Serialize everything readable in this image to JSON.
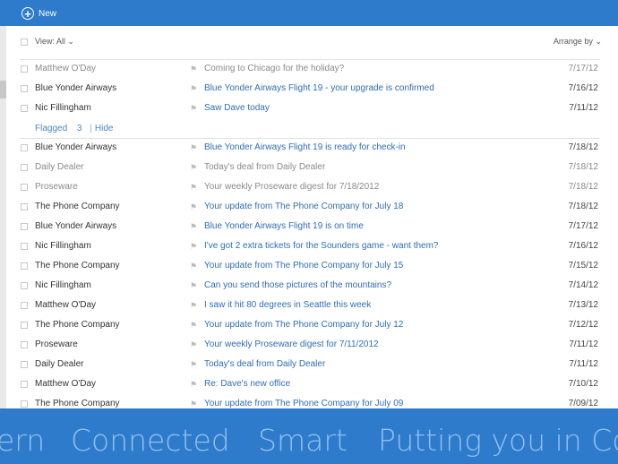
{
  "header": {
    "new_label": "New"
  },
  "toolbar": {
    "view_label": "View: All",
    "arrange_label": "Arrange by"
  },
  "top_messages": [
    {
      "sender": "Matthew O'Day",
      "subject": "Coming to Chicago for the holiday?",
      "date": "7/17/12",
      "unread": false
    },
    {
      "sender": "Blue Yonder Airways",
      "subject": "Blue Yonder Airways Flight 19 - your upgrade is confirmed",
      "date": "7/16/12",
      "unread": true
    },
    {
      "sender": "Nic Fillingham",
      "subject": "Saw Dave today",
      "date": "7/11/12",
      "unread": true
    }
  ],
  "flagged": {
    "label": "Flagged",
    "count": "3",
    "hide_label": "Hide"
  },
  "messages": [
    {
      "sender": "Blue Yonder Airways",
      "subject": "Blue Yonder Airways Flight 19 is ready for check-in",
      "date": "7/18/12",
      "unread": true
    },
    {
      "sender": "Daily Dealer",
      "subject": "Today's deal from Daily Dealer",
      "date": "7/18/12",
      "unread": false
    },
    {
      "sender": "Proseware",
      "subject": "Your weekly Proseware digest for 7/18/2012",
      "date": "7/18/12",
      "unread": false
    },
    {
      "sender": "The Phone Company",
      "subject": "Your update from The Phone Company for July 18",
      "date": "7/18/12",
      "unread": true
    },
    {
      "sender": "Blue Yonder Airways",
      "subject": "Blue Yonder Airways Flight 19 is on time",
      "date": "7/17/12",
      "unread": true
    },
    {
      "sender": "Nic Fillingham",
      "subject": "I've got 2 extra tickets for the Sounders game - want them?",
      "date": "7/16/12",
      "unread": true
    },
    {
      "sender": "The Phone Company",
      "subject": "Your update from The Phone Company for July 15",
      "date": "7/15/12",
      "unread": true
    },
    {
      "sender": "Nic Fillingham",
      "subject": "Can you send those pictures of the mountains?",
      "date": "7/14/12",
      "unread": true
    },
    {
      "sender": "Matthew O'Day",
      "subject": "I saw it hit 80 degrees in Seattle this week",
      "date": "7/13/12",
      "unread": true
    },
    {
      "sender": "The Phone Company",
      "subject": "Your update from The Phone Company for July 12",
      "date": "7/12/12",
      "unread": true
    },
    {
      "sender": "Proseware",
      "subject": "Your weekly Proseware digest for 7/11/2012",
      "date": "7/11/12",
      "unread": true
    },
    {
      "sender": "Daily Dealer",
      "subject": "Today's deal from Daily Dealer",
      "date": "7/11/12",
      "unread": true
    },
    {
      "sender": "Matthew O'Day",
      "subject": "Re: Dave's new office",
      "date": "7/10/12",
      "unread": true
    },
    {
      "sender": "The Phone Company",
      "subject": "Your update from The Phone Company for July 09",
      "date": "7/09/12",
      "unread": true
    }
  ],
  "banner": {
    "words": [
      "ern",
      "Connected",
      "Smart",
      "Putting you in Cor"
    ]
  }
}
